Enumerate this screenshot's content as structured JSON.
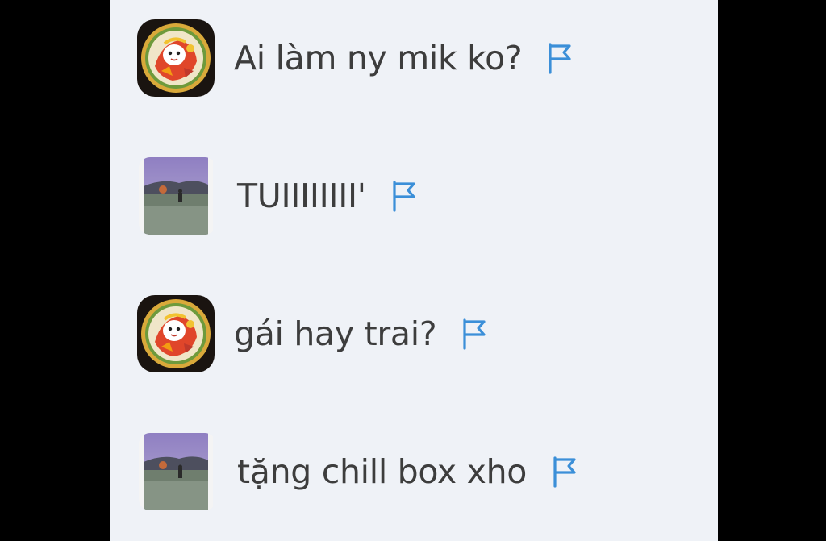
{
  "messages": [
    {
      "avatar": "avatar-cartoon-icon",
      "text": "Ai làm ny mik ko?",
      "flag_icon": "report-flag-icon"
    },
    {
      "avatar": "avatar-landscape-icon",
      "text": "TUIIIIIIII'",
      "flag_icon": "report-flag-icon"
    },
    {
      "avatar": "avatar-cartoon-icon",
      "text": "gái hay trai?",
      "flag_icon": "report-flag-icon"
    },
    {
      "avatar": "avatar-landscape-icon",
      "text": "tặng chill box xho",
      "flag_icon": "report-flag-icon"
    }
  ],
  "colors": {
    "panel_background": "#eff2f7",
    "outer_background": "#000000",
    "message_text": "#3d3d3d",
    "flag_accent": "#3b8fd8"
  }
}
